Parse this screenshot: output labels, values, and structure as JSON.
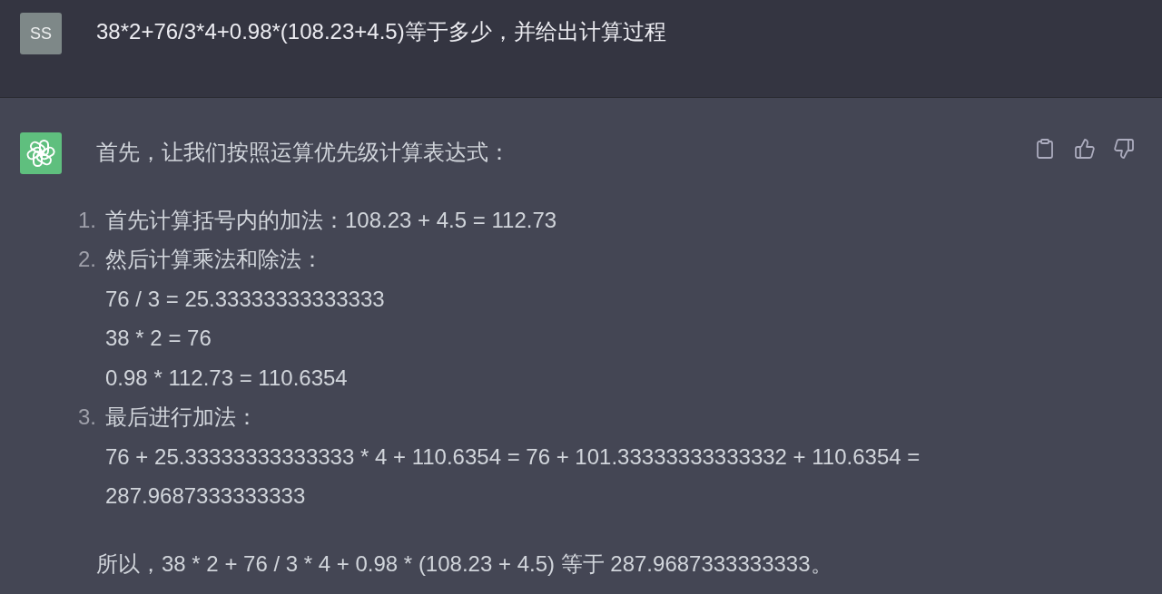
{
  "user_message": {
    "avatar": "SS",
    "text": "38*2+76/3*4+0.98*(108.23+4.5)等于多少，并给出计算过程"
  },
  "assistant_message": {
    "intro": "首先，让我们按照运算优先级计算表达式：",
    "steps": [
      {
        "number": "1.",
        "title": "首先计算括号内的加法：108.23 + 4.5 = 112.73"
      },
      {
        "number": "2.",
        "title": "然后计算乘法和除法：",
        "lines": [
          "76 / 3 = 25.33333333333333",
          "38 * 2 = 76",
          "0.98 * 112.73 = 110.6354"
        ]
      },
      {
        "number": "3.",
        "title": "最后进行加法：",
        "lines": [
          "76 + 25.33333333333333 * 4 + 110.6354 = 76 + 101.33333333333332 + 110.6354 = 287.9687333333333"
        ]
      }
    ],
    "conclusion": "所以，38 * 2 + 76 / 3 * 4 + 0.98 * (108.23 + 4.5) 等于 287.9687333333333。"
  }
}
